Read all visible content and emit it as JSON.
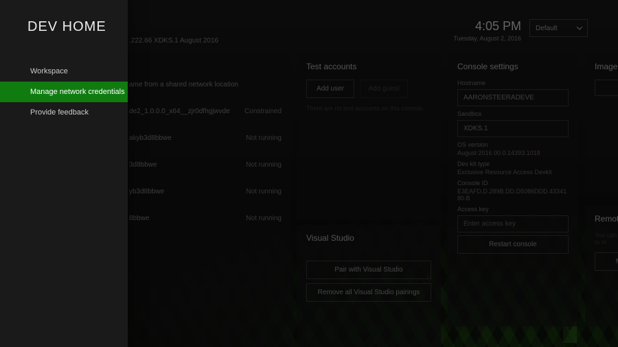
{
  "header": {
    "title": "DEV HOME",
    "subtitle": ".222.66    XDKS.1    August 2016",
    "time": "4:05 PM",
    "date": "Tuesday, August 2, 2016",
    "dropdown": "Default"
  },
  "sidebar": {
    "items": [
      {
        "label": "Workspace"
      },
      {
        "label": "Manage network credentials"
      },
      {
        "label": "Provide feedback"
      }
    ]
  },
  "home": {
    "desc": "ame from a shared network location",
    "rows": [
      {
        "name": "de2_1.0.0.0_x64__zjr0dfhgjwvde",
        "status": "Constrained"
      },
      {
        "name": "akyb3d8bbwe",
        "status": "Not running"
      },
      {
        "name": "3d8bbwe",
        "status": "Not running"
      },
      {
        "name": "yb3d8bbwe",
        "status": "Not running"
      },
      {
        "name": "8bbwe",
        "status": "Not running"
      }
    ]
  },
  "test": {
    "title": "Test accounts",
    "add": "Add user",
    "add_guest": "Add guest",
    "hint": "There are no test accounts on this console."
  },
  "vs": {
    "title": "Visual Studio",
    "pair": "Pair with Visual Studio",
    "remove": "Remove all Visual Studio pairings"
  },
  "console": {
    "title": "Console settings",
    "hostname_l": "Hostname",
    "hostname": "AARONSTEERADEVE",
    "sandbox_l": "Sandbox",
    "sandbox": "XDKS.1",
    "os_l": "OS version",
    "os": "August 2016 00.0.14393.1018",
    "kit_l": "Dev kit type",
    "kit": "Exclusive Resource Access Devkit",
    "cid_l": "Console ID",
    "cid": "E3EAFD.D.289B.DD.D5086DDD.4334180.B",
    "akey_l": "Access key",
    "akey_ph": "Enter access key",
    "restart": "Restart console"
  },
  "image": {
    "title": "Image ca"
  },
  "remote": {
    "title": "Remote",
    "hint": "You can conn browser to m",
    "btn": "Manag"
  }
}
